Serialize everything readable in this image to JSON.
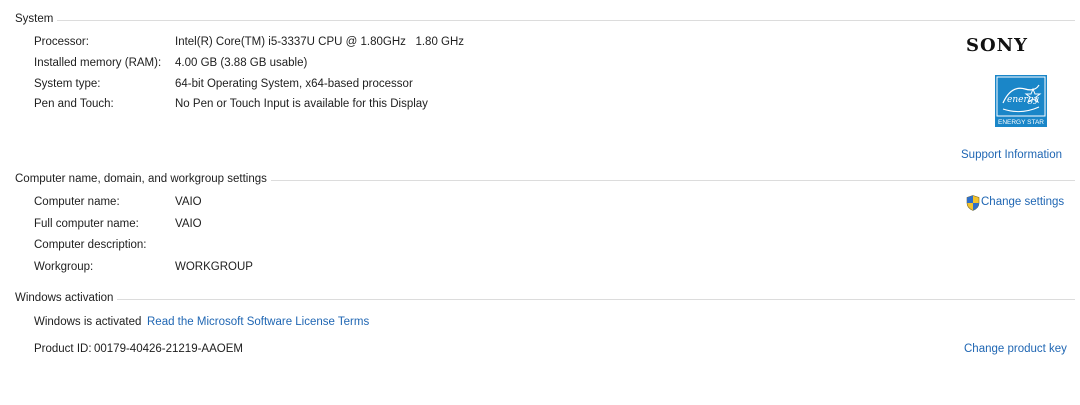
{
  "system": {
    "heading": "System",
    "rows": [
      {
        "label": "Processor:",
        "value": "Intel(R) Core(TM) i5-3337U CPU @ 1.80GHz   1.80 GHz"
      },
      {
        "label": "Installed memory (RAM):",
        "value": "4.00 GB (3.88 GB usable)"
      },
      {
        "label": "System type:",
        "value": "64-bit Operating System, x64-based processor"
      },
      {
        "label": "Pen and Touch:",
        "value": "No Pen or Touch Input is available for this Display"
      }
    ],
    "manufacturer_logo": "SONY",
    "energy_star_label": "ENERGY STAR",
    "energy_star_script": "energy",
    "support_link": "Support Information"
  },
  "computer": {
    "heading": "Computer name, domain, and workgroup settings",
    "rows": [
      {
        "label": "Computer name:",
        "value": "VAIO"
      },
      {
        "label": "Full computer name:",
        "value": "VAIO"
      },
      {
        "label": "Computer description:",
        "value": ""
      },
      {
        "label": "Workgroup:",
        "value": "WORKGROUP"
      }
    ],
    "change_settings": "Change settings",
    "change_settings_icon": "uac-shield-icon"
  },
  "activation": {
    "heading": "Windows activation",
    "status": "Windows is activated",
    "license_link": "Read the Microsoft Software License Terms",
    "product_id_label": "Product ID:",
    "product_id": "00179-40426-21219-AAOEM",
    "change_key": "Change product key"
  },
  "colors": {
    "link": "#1f66b3",
    "energy_star": "#1a86c8",
    "divider": "#dcdcdc"
  }
}
